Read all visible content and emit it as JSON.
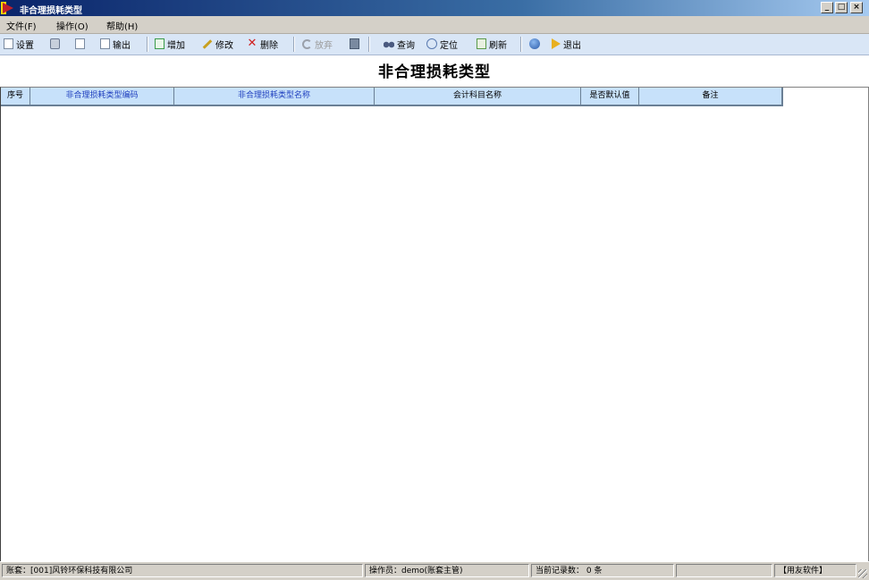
{
  "window": {
    "title": "非合理损耗类型",
    "min_label": "_",
    "max_label": "□",
    "close_label": "×"
  },
  "menu": {
    "items": [
      "文件(F)",
      "操作(O)",
      "帮助(H)"
    ]
  },
  "toolbar": {
    "setup_label": "设置",
    "output_label": "输出",
    "add_label": "增加",
    "modify_label": "修改",
    "delete_label": "删除",
    "abandon_label": "放弃",
    "query_label": "查询",
    "locate_label": "定位",
    "refresh_label": "刷新",
    "exit_label": "退出"
  },
  "page": {
    "heading": "非合理损耗类型"
  },
  "table": {
    "columns": [
      "序号",
      "非合理损耗类型编码",
      "非合理损耗类型名称",
      "会计科目名称",
      "是否默认值",
      "备注"
    ],
    "rows": []
  },
  "status": {
    "account": "账套：[001]风铃环保科技有限公司",
    "operator": "操作员：demo(账套主管)",
    "record_count": "当前记录数： 0 条",
    "brand": "【用友软件】"
  },
  "colors": {
    "header_bg": "#c7e1fa",
    "toolbar_bg": "#d9e6f6",
    "column_text": "#1f3fbf"
  }
}
